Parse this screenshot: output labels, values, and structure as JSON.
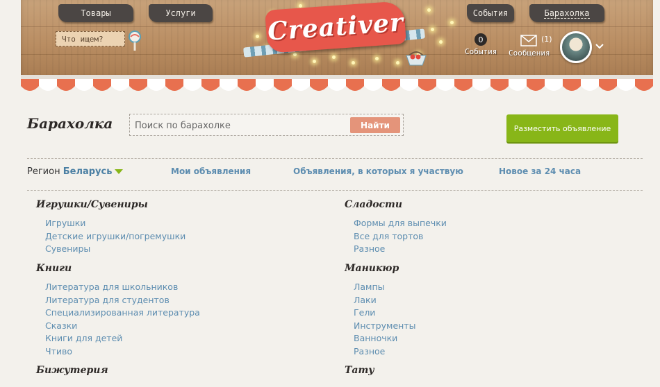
{
  "header": {
    "nav": {
      "goods": "Товары",
      "services": "Услуги",
      "events": "События",
      "flea_market": "Барахолка"
    },
    "search_placeholder": "Что ищем?",
    "logo_text": "Creativer",
    "events_count": "0",
    "events_label": "События",
    "messages_count": "(1)",
    "messages_label": "Сообщения"
  },
  "main": {
    "title": "Барахолка",
    "search_placeholder": "Поиск по барахолке",
    "find_button": "Найти",
    "post_button": "Разместить объявление",
    "region_label": "Регион",
    "region_value": "Беларусь",
    "links": {
      "my_ads": "Мои объявления",
      "participating": "Объявления, в которых я участвую",
      "new_24h": "Новое за 24 часа"
    }
  },
  "categories": {
    "toys": {
      "title": "Игрушки/Сувениры",
      "items": [
        "Игрушки",
        "Детские игрушки/погремушки",
        "Сувениры"
      ]
    },
    "books": {
      "title": "Книги",
      "items": [
        "Литература для школьников",
        "Литература для студентов",
        "Специализированная литература",
        "Сказки",
        "Книги для детей",
        "Чтиво"
      ]
    },
    "jewelry": {
      "title": "Бижутерия"
    },
    "sweets": {
      "title": "Сладости",
      "items": [
        "Формы для выпечки",
        "Все для тортов",
        "Разное"
      ]
    },
    "manicure": {
      "title": "Маникюр",
      "items": [
        "Лампы",
        "Лаки",
        "Гели",
        "Инструменты",
        "Ванночки",
        "Разное"
      ]
    },
    "tattoo": {
      "title": "Тату"
    }
  },
  "colors": {
    "accent_green": "#88b618",
    "link_blue": "#5d8db0",
    "logo_red": "#e7574b",
    "find_button": "#e4947a"
  },
  "icons": [
    "lollipop-search-icon",
    "basket-icon",
    "mail-icon",
    "chevron-down-icon",
    "triangle-down-icon"
  ]
}
